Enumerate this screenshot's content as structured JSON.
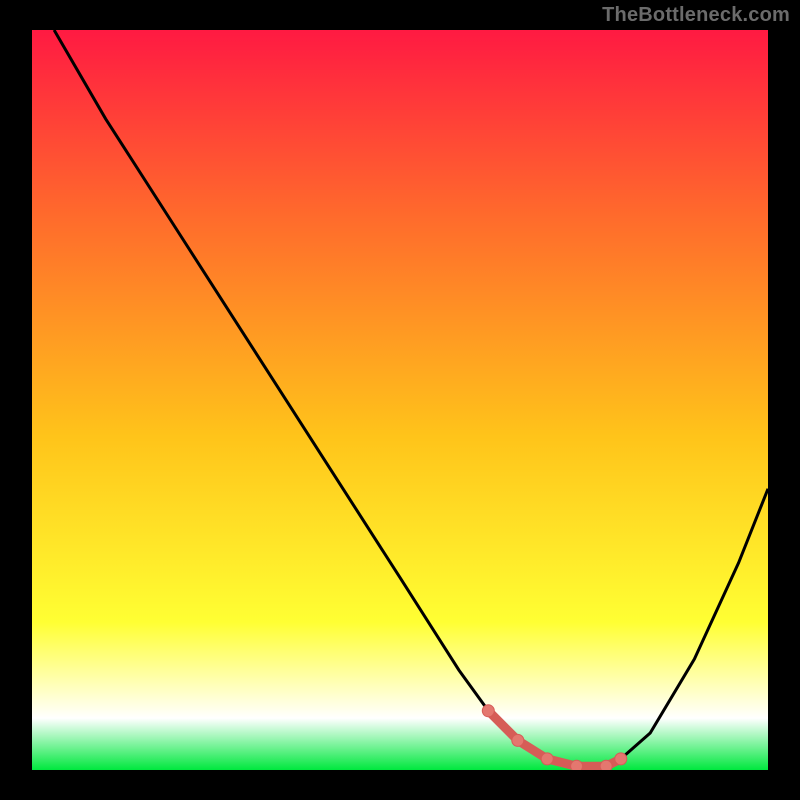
{
  "attribution": "TheBottleneck.com",
  "colors": {
    "frame": "#000000",
    "grad_top": "#ff1a42",
    "grad_mid_upper": "#ff6a2c",
    "grad_mid": "#ffc41a",
    "grad_lower": "#ffff33",
    "grad_white": "#ffffff",
    "grad_bottom": "#00e83e",
    "curve": "#000000",
    "marker_fill": "#e4776f",
    "marker_stroke": "#d65c57"
  },
  "chart_data": {
    "type": "line",
    "title": "",
    "xlabel": "",
    "ylabel": "",
    "xlim": [
      0,
      100
    ],
    "ylim": [
      0,
      100
    ],
    "series": [
      {
        "name": "curve",
        "x": [
          3,
          10,
          20,
          30,
          40,
          50,
          58,
          62,
          66,
          70,
          74,
          78,
          80,
          84,
          90,
          96,
          100
        ],
        "values": [
          100,
          88,
          72.5,
          57,
          41.5,
          26,
          13.5,
          8,
          4,
          1.5,
          0.5,
          0.5,
          1.5,
          5,
          15,
          28,
          38
        ]
      }
    ],
    "segment_markers": {
      "x": [
        62,
        66,
        70,
        74,
        78,
        80
      ],
      "values": [
        8,
        4,
        1.5,
        0.5,
        0.5,
        1.5
      ]
    }
  }
}
